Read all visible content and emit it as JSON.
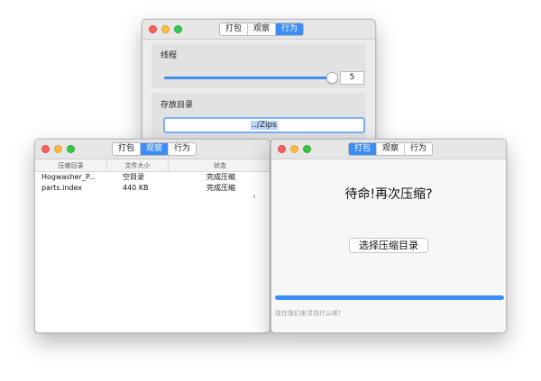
{
  "tabs": [
    "打包",
    "观察",
    "行为"
  ],
  "settings_window": {
    "thread_label": "线程",
    "thread_value": "5",
    "slider_level": 0.96,
    "dir_label": "存放目录",
    "dir_value": "../Zips",
    "active_tab": 2
  },
  "list_window": {
    "active_tab": 1,
    "headers": [
      "压缩目录",
      "文件大小",
      "状态"
    ],
    "rows": [
      {
        "name": "Hogwasher_P...",
        "size": "空目录",
        "status": "完成压缩"
      },
      {
        "name": "parts.index",
        "size": "440 KB",
        "status": "完成压缩"
      }
    ]
  },
  "compress_window": {
    "active_tab": 0,
    "title": "待命!再次压缩?",
    "choose_button": "选择压缩目录",
    "progress": 1.0,
    "search_placeholder": "现在我们来寻找什么呢?"
  },
  "colors": {
    "accent": "#3c8df5",
    "close": "#fc605c",
    "minimize": "#fdbc40",
    "zoom": "#34c84a"
  }
}
